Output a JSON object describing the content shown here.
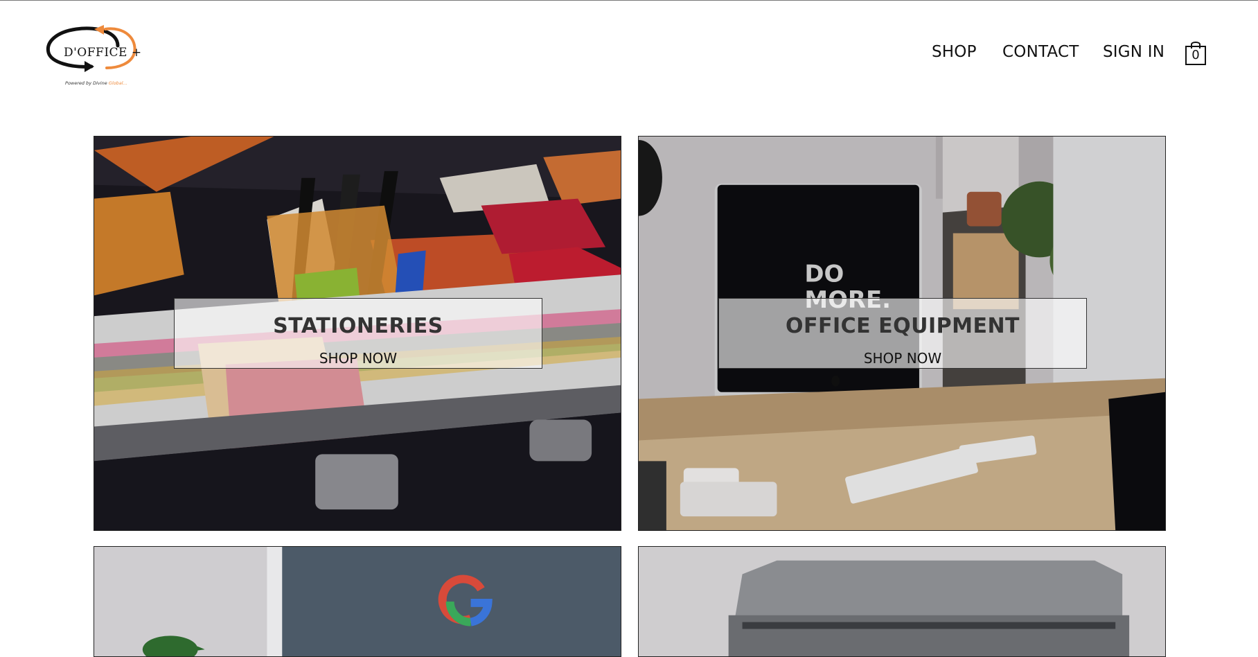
{
  "brand": {
    "logo_text": "D'OFFICE +",
    "tagline_prefix": "Powered by Divine",
    "tagline_highlight": "Global...",
    "accent_color": "#ee8a3c"
  },
  "nav": {
    "items": [
      {
        "label": "SHOP"
      },
      {
        "label": "CONTACT"
      },
      {
        "label": "SIGN IN"
      }
    ],
    "cart_count": "0",
    "cart_icon": "shopping-bag-icon"
  },
  "categories": [
    {
      "title": "STATIONERIES",
      "cta": "SHOP NOW",
      "image": "stationery-case-photo"
    },
    {
      "title": "OFFICE EQUIPMENT",
      "cta": "SHOP NOW",
      "image": "desk-computer-photo",
      "screen_text": "DO MORE."
    },
    {
      "title": "",
      "cta": "",
      "image": "monitor-google-photo"
    },
    {
      "title": "",
      "cta": "",
      "image": "printer-photo"
    }
  ]
}
